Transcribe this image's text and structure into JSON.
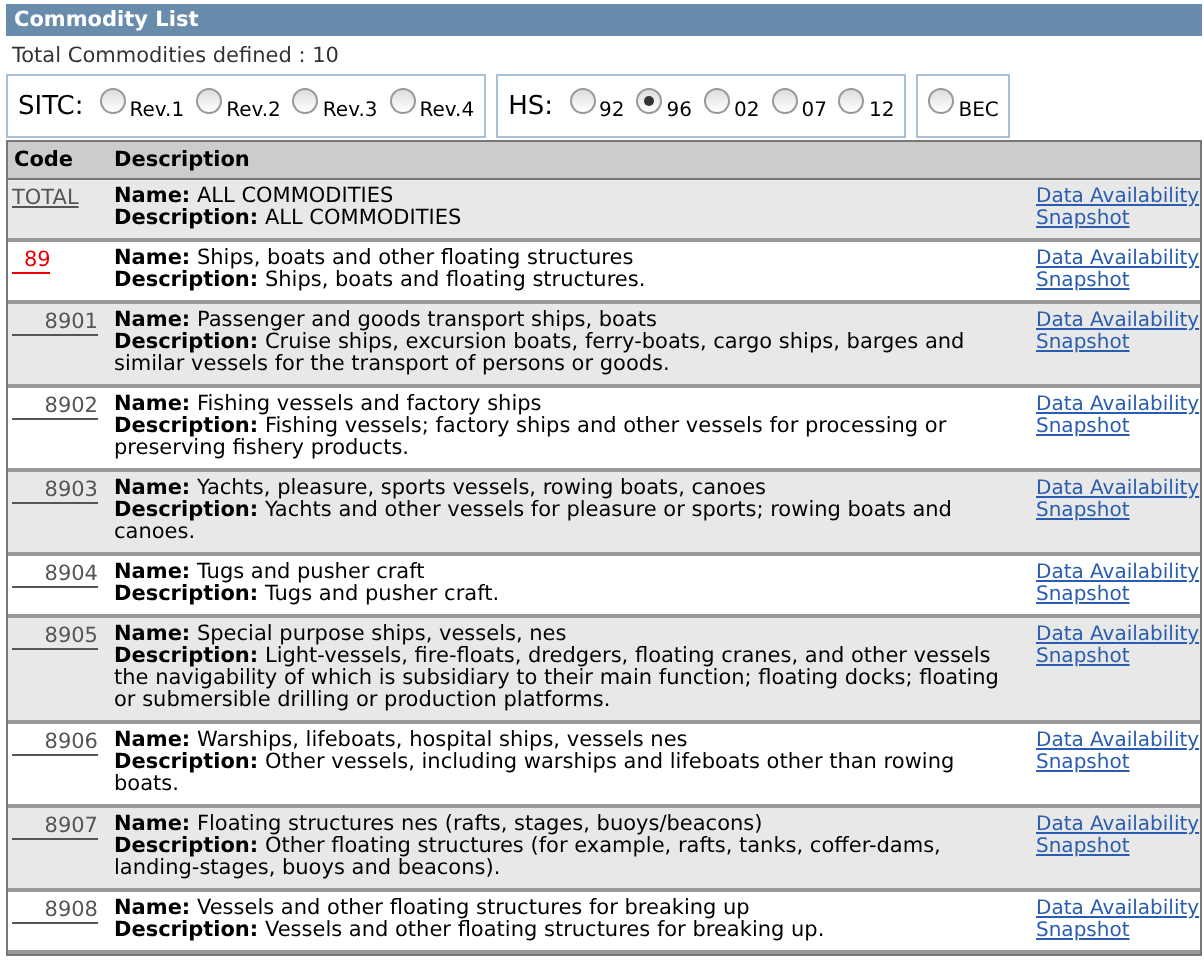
{
  "panel": {
    "title": "Commodity List"
  },
  "summary": "Total Commodities defined : 10",
  "classifications": [
    {
      "label": "SITC:",
      "options": [
        {
          "label": "Rev.1",
          "selected": false
        },
        {
          "label": "Rev.2",
          "selected": false
        },
        {
          "label": "Rev.3",
          "selected": false
        },
        {
          "label": "Rev.4",
          "selected": false
        }
      ]
    },
    {
      "label": "HS:",
      "options": [
        {
          "label": "92",
          "selected": false
        },
        {
          "label": "96",
          "selected": true
        },
        {
          "label": "02",
          "selected": false
        },
        {
          "label": "07",
          "selected": false
        },
        {
          "label": "12",
          "selected": false
        }
      ]
    },
    {
      "options": [
        {
          "label": "BEC",
          "selected": false
        }
      ]
    }
  ],
  "table": {
    "columns": [
      "Code",
      "Description"
    ],
    "rows": [
      {
        "code": "TOTAL",
        "kind": "total",
        "name_label": "Name:",
        "name": "ALL COMMODITIES",
        "description_label": "Description:",
        "description": "ALL COMMODITIES",
        "links": [
          "Data Availability",
          "Snapshot"
        ]
      },
      {
        "code": "89",
        "kind": "chapter",
        "name_label": "Name:",
        "name": "Ships, boats and other floating structures",
        "description_label": "Description:",
        "description": "Ships, boats and floating structures.",
        "links": [
          "Data Availability",
          "Snapshot"
        ]
      },
      {
        "code": "8901",
        "kind": "heading",
        "name_label": "Name:",
        "name": "Passenger and goods transport ships, boats",
        "description_label": "Description:",
        "description": "Cruise ships, excursion boats, ferry-boats, cargo ships, barges and similar vessels for the transport of persons or goods.",
        "links": [
          "Data Availability",
          "Snapshot"
        ]
      },
      {
        "code": "8902",
        "kind": "heading",
        "name_label": "Name:",
        "name": "Fishing vessels and factory ships",
        "description_label": "Description:",
        "description": "Fishing vessels; factory ships and other vessels for processing or preserving fishery products.",
        "links": [
          "Data Availability",
          "Snapshot"
        ]
      },
      {
        "code": "8903",
        "kind": "heading",
        "name_label": "Name:",
        "name": "Yachts, pleasure, sports vessels, rowing boats, canoes",
        "description_label": "Description:",
        "description": "Yachts and other vessels for pleasure or sports; rowing boats and canoes.",
        "links": [
          "Data Availability",
          "Snapshot"
        ]
      },
      {
        "code": "8904",
        "kind": "heading",
        "name_label": "Name:",
        "name": "Tugs and pusher craft",
        "description_label": "Description:",
        "description": "Tugs and pusher craft.",
        "links": [
          "Data Availability",
          "Snapshot"
        ]
      },
      {
        "code": "8905",
        "kind": "heading",
        "name_label": "Name:",
        "name": "Special purpose ships, vessels, nes",
        "description_label": "Description:",
        "description": "Light-vessels, fire-floats, dredgers, floating cranes, and other vessels the navigability of which is subsidiary to their main function; floating docks; floating or submersible drilling or production platforms.",
        "links": [
          "Data Availability",
          "Snapshot"
        ]
      },
      {
        "code": "8906",
        "kind": "heading",
        "name_label": "Name:",
        "name": "Warships, lifeboats, hospital ships, vessels nes",
        "description_label": "Description:",
        "description": "Other vessels, including warships and lifeboats other than rowing boats.",
        "links": [
          "Data Availability",
          "Snapshot"
        ]
      },
      {
        "code": "8907",
        "kind": "heading",
        "name_label": "Name:",
        "name": "Floating structures nes (rafts, stages, buoys/beacons)",
        "description_label": "Description:",
        "description": "Other floating structures (for example, rafts, tanks, coffer-dams, landing-stages, buoys and beacons).",
        "links": [
          "Data Availability",
          "Snapshot"
        ]
      },
      {
        "code": "8908",
        "kind": "heading",
        "name_label": "Name:",
        "name": "Vessels and other floating structures for breaking up",
        "description_label": "Description:",
        "description": "Vessels and other floating structures for breaking up.",
        "links": [
          "Data Availability",
          "Snapshot"
        ]
      }
    ]
  }
}
